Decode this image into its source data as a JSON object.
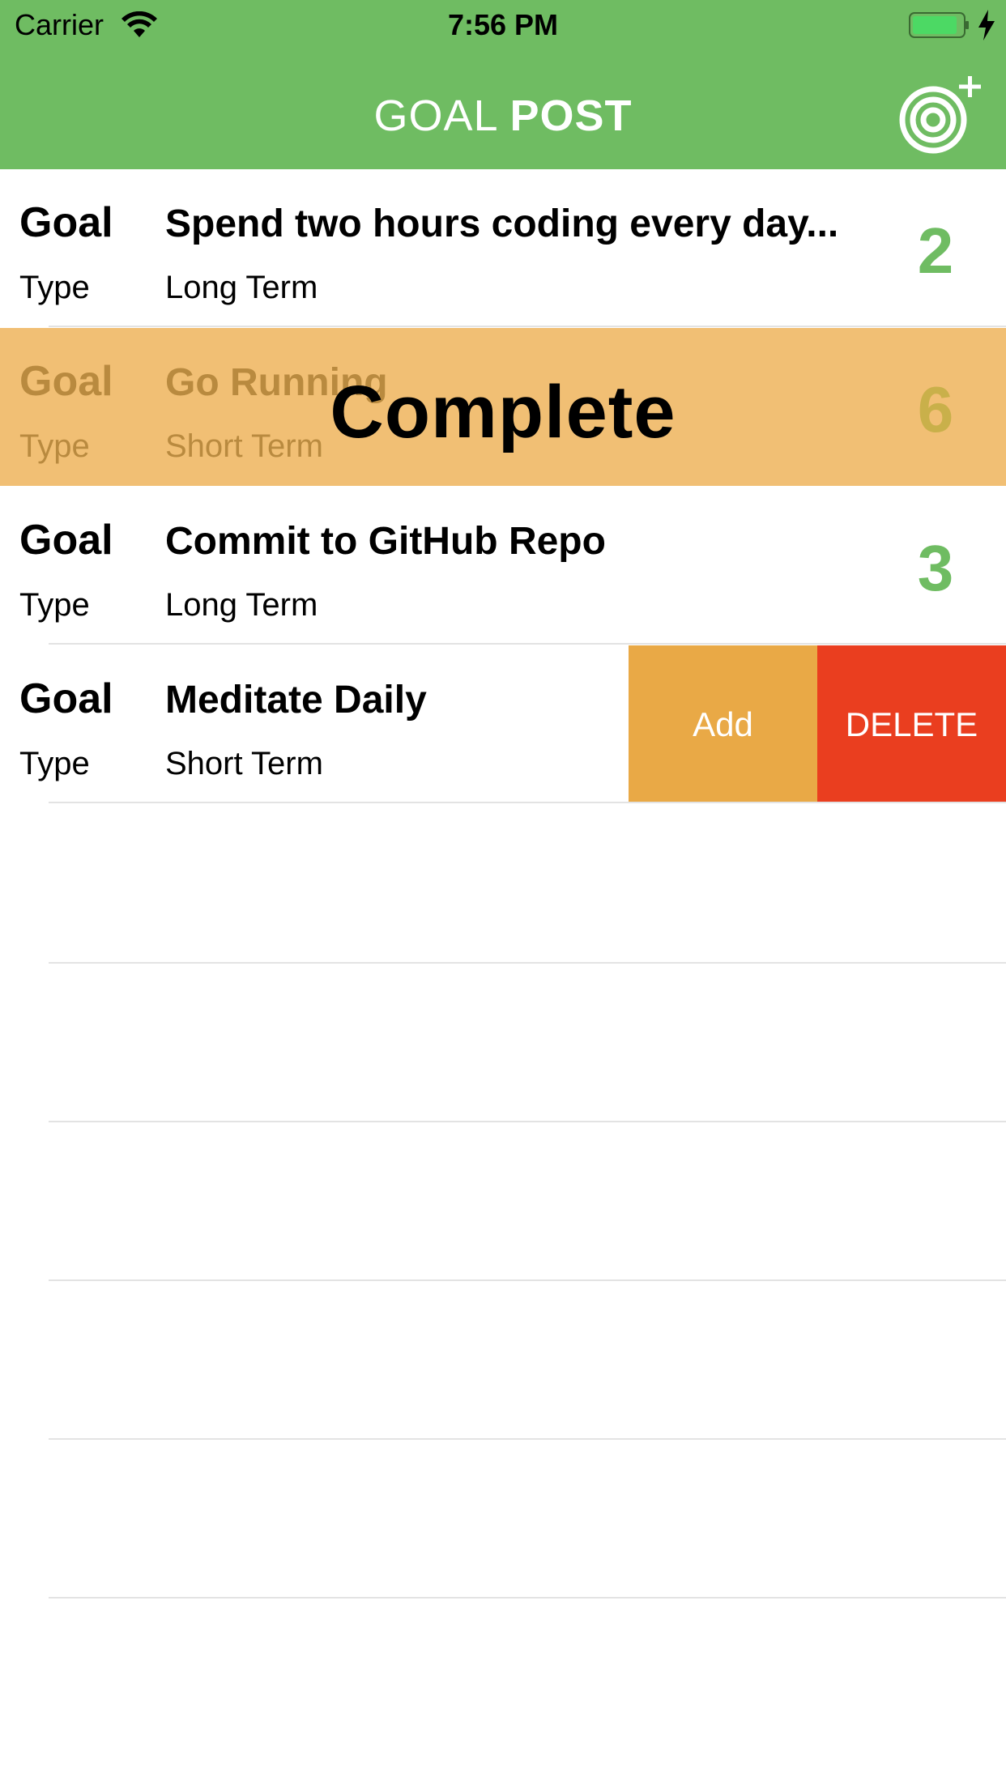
{
  "status_bar": {
    "carrier": "Carrier",
    "time": "7:56 PM"
  },
  "header": {
    "title_light": "GOAL ",
    "title_bold": "POST",
    "add_icon": "target-plus-icon"
  },
  "colors": {
    "header_green": "#6fbc62",
    "complete_orange": "#f1bf74",
    "add_action": "#e9a946",
    "delete_action": "#ea3e1f"
  },
  "goals": [
    {
      "goal_key": "Goal",
      "goal": "Spend two hours coding every day...",
      "type_key": "Type",
      "type": "Long Term",
      "progress": "2"
    },
    {
      "goal_key": "Goal",
      "goal": "Go Running",
      "type_key": "Type",
      "type": "Short Term",
      "progress": "6",
      "overlay": "Complete"
    },
    {
      "goal_key": "Goal",
      "goal": "Commit to GitHub Repo",
      "type_key": "Type",
      "type": "Long Term",
      "progress": "3"
    },
    {
      "goal_key": "Goal",
      "goal": "Meditate Daily",
      "type_key": "Type",
      "type": "Short Term",
      "actions": {
        "add": "Add",
        "delete": "DELETE"
      }
    }
  ]
}
